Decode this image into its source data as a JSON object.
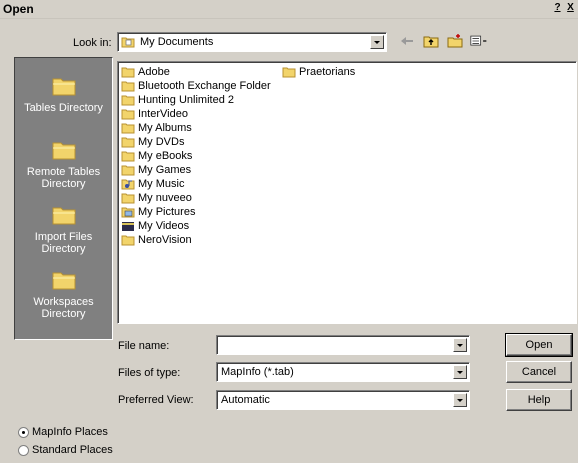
{
  "window": {
    "title": "Open",
    "help_label": "?",
    "close_label": "X"
  },
  "look_in": {
    "label": "Look in:",
    "value": "My Documents"
  },
  "toolbar": {
    "back_icon": "back-arrow-icon",
    "up_icon": "up-folder-icon",
    "new_folder_icon": "new-folder-icon",
    "views_icon": "views-menu-icon"
  },
  "places": [
    {
      "label": "Tables Directory"
    },
    {
      "label": "Remote Tables Directory"
    },
    {
      "label": "Import Files Directory"
    },
    {
      "label": "Workspaces Directory"
    }
  ],
  "files": [
    {
      "name": "Adobe",
      "icon": "folder-icon"
    },
    {
      "name": "Bluetooth Exchange Folder",
      "icon": "folder-icon"
    },
    {
      "name": "Hunting Unlimited 2",
      "icon": "folder-icon"
    },
    {
      "name": "InterVideo",
      "icon": "folder-icon"
    },
    {
      "name": "My Albums",
      "icon": "folder-icon"
    },
    {
      "name": "My DVDs",
      "icon": "folder-icon"
    },
    {
      "name": "My eBooks",
      "icon": "folder-icon"
    },
    {
      "name": "My Games",
      "icon": "folder-icon"
    },
    {
      "name": "My Music",
      "icon": "music-folder-icon"
    },
    {
      "name": "My nuveeo",
      "icon": "folder-icon"
    },
    {
      "name": "My Pictures",
      "icon": "pictures-folder-icon"
    },
    {
      "name": "My Videos",
      "icon": "videos-folder-icon"
    },
    {
      "name": "NeroVision",
      "icon": "folder-icon"
    },
    {
      "name": "Praetorians",
      "icon": "folder-icon"
    }
  ],
  "form": {
    "file_name_label": "File name:",
    "file_name_value": "",
    "file_type_label": "Files of type:",
    "file_type_value": "MapInfo (*.tab)",
    "pref_view_label": "Preferred View:",
    "pref_view_value": "Automatic"
  },
  "buttons": {
    "open": "Open",
    "cancel": "Cancel",
    "help": "Help"
  },
  "place_options": [
    {
      "label": "MapInfo Places",
      "selected": true
    },
    {
      "label": "Standard Places",
      "selected": false
    }
  ],
  "colors": {
    "folder": "#f2d46b",
    "folder_edge": "#b89230",
    "face": "#d4d0c8"
  }
}
